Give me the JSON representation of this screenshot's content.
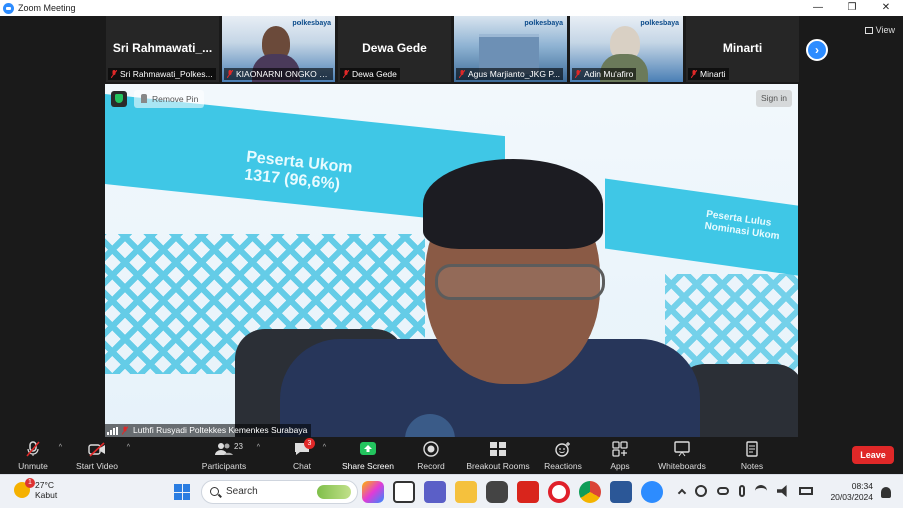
{
  "window": {
    "title": "Zoom Meeting",
    "controls": [
      "—",
      "❐",
      "✕"
    ]
  },
  "gallery": {
    "tiles": [
      {
        "type": "name",
        "big_name": "Sri  Rahmawati_...",
        "label": "Sri Rahmawati_Polkes..."
      },
      {
        "type": "video",
        "brand": "p𝗼lkesbaya",
        "label": "KIAONARNI ONGKO W..."
      },
      {
        "type": "name",
        "big_name": "Dewa Gede",
        "label": "Dewa Gede"
      },
      {
        "type": "building",
        "brand": "p𝗼lkesbaya",
        "label": "Agus Marjianto_JKG P..."
      },
      {
        "type": "hijab",
        "brand": "p𝗼lkesbaya",
        "label": "Adin Mu'afiro"
      },
      {
        "type": "name",
        "big_name": "Minarti",
        "label": "Minarti"
      }
    ],
    "next_label": "›",
    "view_label": "View"
  },
  "main": {
    "remove_pin": "Remove Pin",
    "sign_in": "Sign in",
    "speaker_label": "Luthfi Rusyadi Poltekkes Kemenkes Surabaya",
    "slide_text_1": "Peserta Ukom\n1317 (96,6%)",
    "slide_text_2": "Peserta Lulus\nNominasi Ukom"
  },
  "toolbar": {
    "unmute": "Unmute",
    "start_video": "Start Video",
    "participants": "Participants",
    "participants_count": "23",
    "chat": "Chat",
    "chat_badge": "3",
    "share_screen": "Share Screen",
    "record": "Record",
    "breakout_rooms": "Breakout Rooms",
    "reactions": "Reactions",
    "apps": "Apps",
    "whiteboards": "Whiteboards",
    "notes": "Notes",
    "leave": "Leave",
    "caret": "^"
  },
  "taskbar": {
    "weather_temp": "27°C",
    "weather_desc": "Kabut",
    "weather_badge": "1",
    "search_placeholder": "Search",
    "time": "08:34",
    "date": "20/03/2024"
  },
  "colors": {
    "zoom_blue": "#2d8cff",
    "leave_red": "#e02828",
    "share_green": "#23c45e",
    "slide_cyan": "#3fc7e6"
  }
}
